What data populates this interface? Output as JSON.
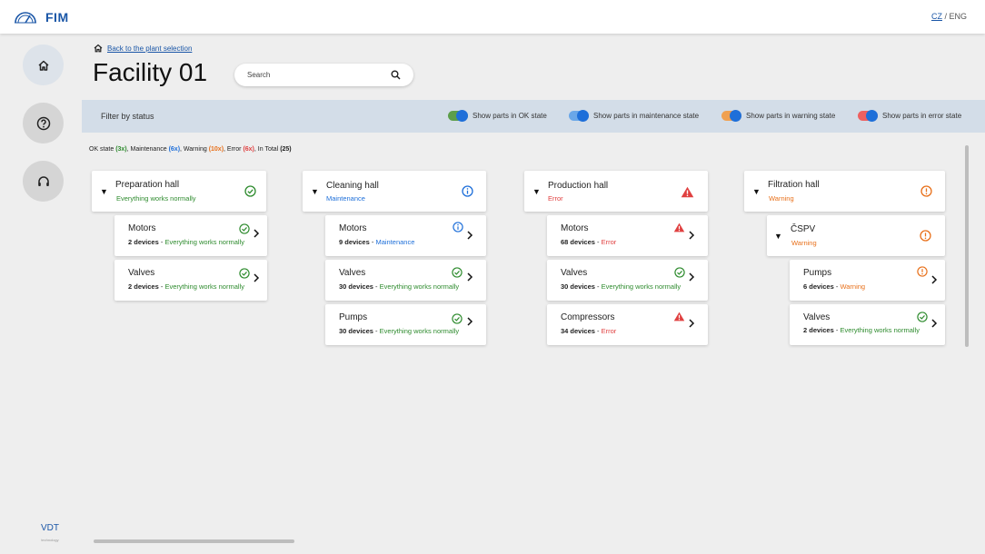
{
  "app": {
    "name": "FIM"
  },
  "lang": {
    "cz": "CZ",
    "sep": " / ",
    "eng": "ENG"
  },
  "breadcrumb": {
    "back_label": "Back to the plant selection"
  },
  "page": {
    "title": "Facility 01"
  },
  "search": {
    "placeholder": "Search"
  },
  "filter": {
    "title": "Filter by status",
    "toggles": [
      {
        "label": "Show parts in OK state",
        "on": true,
        "color": "#5c9e4a"
      },
      {
        "label": "Show parts in maintenance state",
        "on": true,
        "color": "#6aa7e8"
      },
      {
        "label": "Show parts in warning state",
        "on": true,
        "color": "#f0a050"
      },
      {
        "label": "Show parts in error state",
        "on": true,
        "color": "#ee6060"
      }
    ]
  },
  "summary": {
    "ok_label": "OK state",
    "ok_count": "(3x)",
    "mt_label": "Maintenance",
    "mt_count": "(6x)",
    "wn_label": "Warning",
    "wn_count": "(10x)",
    "er_label": "Error",
    "er_count": "(6x)",
    "total_label": "In Total",
    "total_count": "(25)"
  },
  "halls": [
    {
      "name": "Preparation hall",
      "status": "Everything works normally",
      "state": "ok",
      "items": [
        {
          "name": "Motors",
          "devices": "2 devices",
          "status": "Everything works normally",
          "state": "ok"
        },
        {
          "name": "Valves",
          "devices": "2 devices",
          "status": "Everything works normally",
          "state": "ok"
        }
      ]
    },
    {
      "name": "Cleaning hall",
      "status": "Maintenance",
      "state": "mt",
      "items": [
        {
          "name": "Motors",
          "devices": "9 devices",
          "status": "Maintenance",
          "state": "mt"
        },
        {
          "name": "Valves",
          "devices": "30 devices",
          "status": "Everything works normally",
          "state": "ok"
        },
        {
          "name": "Pumps",
          "devices": "30 devices",
          "status": "Everything works normally",
          "state": "ok"
        }
      ]
    },
    {
      "name": "Production hall",
      "status": "Error",
      "state": "er",
      "items": [
        {
          "name": "Motors",
          "devices": "68 devices",
          "status": "Error",
          "state": "er"
        },
        {
          "name": "Valves",
          "devices": "30 devices",
          "status": "Everything works normally",
          "state": "ok"
        },
        {
          "name": "Compressors",
          "devices": "34 devices",
          "status": "Error",
          "state": "er"
        }
      ]
    },
    {
      "name": "Filtration hall",
      "status": "Warning",
      "state": "wn",
      "sub": {
        "name": "ČSPV",
        "status": "Warning",
        "state": "wn"
      },
      "items": [
        {
          "name": "Pumps",
          "devices": "6 devices",
          "status": "Warning",
          "state": "wn"
        },
        {
          "name": "Valves",
          "devices": "2 devices",
          "status": "Everything works normally",
          "state": "ok"
        }
      ]
    }
  ],
  "colors": {
    "ok": "#2e8b2e",
    "mt": "#1e6fd9",
    "wn": "#e8701a",
    "er": "#e04040",
    "brand": "#1a56a7"
  },
  "footer": {
    "logo": "VDT",
    "logo_sub": "technology"
  }
}
